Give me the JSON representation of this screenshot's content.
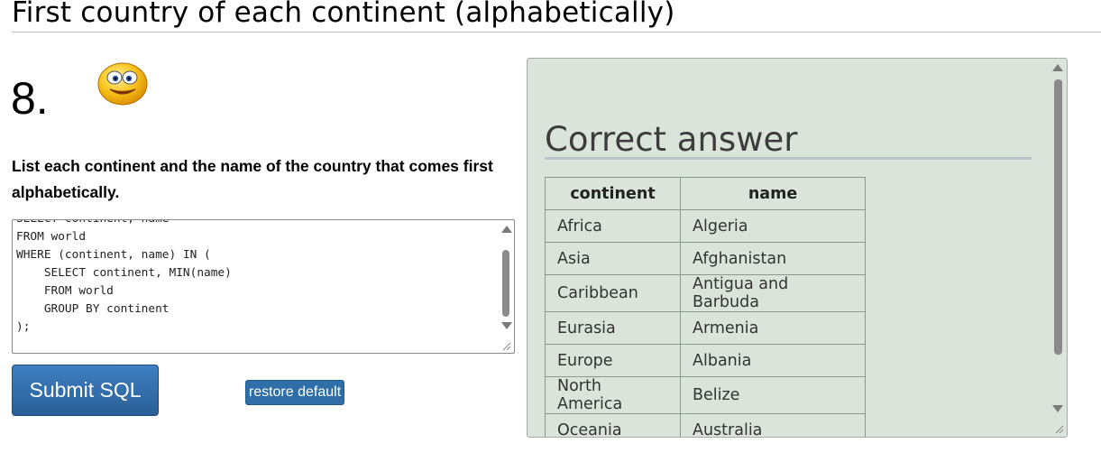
{
  "page": {
    "title": "First country of each continent (alphabetically)",
    "question_number": "8.",
    "question_text": "List each continent and the name of the country that comes first alphabetically."
  },
  "icons": {
    "smiley": "smiley-face-icon"
  },
  "editor": {
    "code": "SELECT continent, name\nFROM world\nWHERE (continent, name) IN (\n    SELECT continent, MIN(name)\n    FROM world\n    GROUP BY continent\n);"
  },
  "buttons": {
    "submit_label": "Submit SQL",
    "restore_label": "restore default"
  },
  "answer": {
    "heading": "Correct answer",
    "columns": [
      "continent",
      "name"
    ],
    "rows": [
      [
        "Africa",
        "Algeria"
      ],
      [
        "Asia",
        "Afghanistan"
      ],
      [
        "Caribbean",
        "Antigua and Barbuda"
      ],
      [
        "Eurasia",
        "Armenia"
      ],
      [
        "Europe",
        "Albania"
      ],
      [
        "North America",
        "Belize"
      ],
      [
        "Oceania",
        "Australia"
      ]
    ]
  },
  "colors": {
    "answer_panel_bg": "#dae4da",
    "submit_button": "#2f6ea7"
  }
}
